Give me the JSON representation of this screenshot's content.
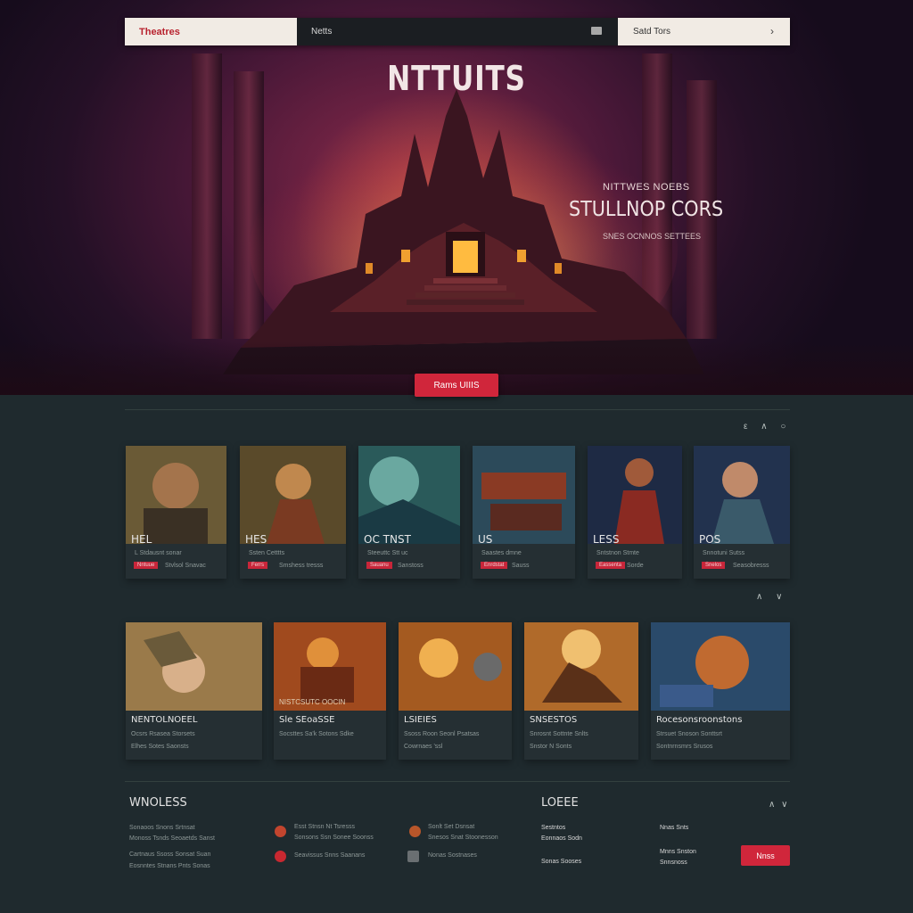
{
  "topbar": {
    "brand": "Theatres",
    "search_text": "Netts",
    "account_label": "Satd Tors"
  },
  "hero": {
    "title": "NTTUITS",
    "kicker": "NITTWES NOEBS",
    "subtitle": "STULLNOP CORS",
    "description": "SNES OCNNOS SETTEES",
    "cta_label": "Rams UIIIS"
  },
  "row1": {
    "icons": "ε ∧ ○",
    "cards": [
      {
        "title": "HEL",
        "meta1": "L Stdausnt sonar",
        "tag": "Nntuue",
        "meta2": "Stvlsol Snavac"
      },
      {
        "title": "HES",
        "meta1": "Ssten Cetttts",
        "tag": "Ferrs",
        "meta2": "Smshess tresss"
      },
      {
        "title": "OC TNST",
        "meta1": "Steeuttc Stt uc",
        "tag": "Sauanu",
        "meta2": "Sanstoss"
      },
      {
        "title": "US",
        "meta1": "Saastes dmne",
        "tag": "Enrdstat",
        "meta2": "Sauss"
      },
      {
        "title": "LESS",
        "meta1": "Sntstnon Stmte",
        "tag": "Eassenta",
        "meta2": "Sorde"
      },
      {
        "title": "POS",
        "meta1": "Snnotuni Sutss",
        "tag": "Snelos",
        "meta2": "Seasobresss"
      }
    ]
  },
  "row2": {
    "icons": "∧ ∨",
    "cards": [
      {
        "title": "NENTOLNOEEL",
        "meta1": "Ocsrs Rsasea Storsets",
        "meta2": "Elhes Sotes Saonsts"
      },
      {
        "title": "Sle SEoaSSE",
        "meta1": "Socsttes Sa'k Sotons Sdke",
        "meta2": "",
        "overlay": "NISTCSUTC OOCIN"
      },
      {
        "title": "LSIEIES",
        "meta1": "Ssoss Roon Seonl Psatsas",
        "meta2": "Cowrnaes 'ssl"
      },
      {
        "title": "SNSESTOS",
        "meta1": "Snrosnt Sottnte Snlts",
        "meta2": "Snstor N Sonts"
      },
      {
        "title": "Rocesonsroonstons",
        "meta1": "Strsuet Snoson Sonttsrt",
        "meta2": "Sontnrnsmrs Srusos"
      }
    ]
  },
  "footer": {
    "col1_title": "WNOLESS",
    "col1_lines": [
      "Sonaoos Snons Srtnsat",
      "Monoss Tsnds Seoaetds Sanst",
      "Cartnaus Ssoss Sonsat Suan",
      "Eosnntes Stnans Pnts Sonas"
    ],
    "col2_lines": [
      "Esst Stnsn Nt Tsresss",
      "Sonsons Ssn Sonee Soonss",
      "Seavissus Snns Saanans"
    ],
    "col3_lines": [
      "Sonlt Set Dsnsat",
      "Snesos Snat Stoonesson",
      "Nonas Sostnases"
    ],
    "col4_title": "LOEEE",
    "col4_icons": "∧ ∨",
    "col4_lines": [
      "Sestntos",
      "Eonnaos Sodn",
      "Sonas Sooses"
    ],
    "col5_lines": [
      "Nnas Snts",
      "Mnns Snston",
      "Snnsnoss"
    ],
    "subscribe_label": "Nnss"
  }
}
